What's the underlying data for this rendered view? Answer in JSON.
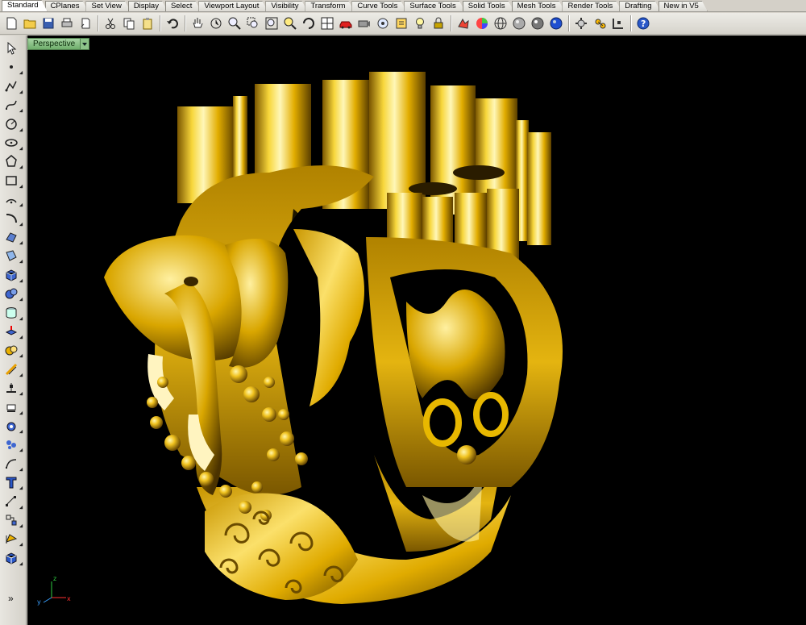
{
  "tabs": [
    {
      "label": "Standard",
      "active": true
    },
    {
      "label": "CPlanes"
    },
    {
      "label": "Set View"
    },
    {
      "label": "Display"
    },
    {
      "label": "Select"
    },
    {
      "label": "Viewport Layout"
    },
    {
      "label": "Visibility"
    },
    {
      "label": "Transform"
    },
    {
      "label": "Curve Tools"
    },
    {
      "label": "Surface Tools"
    },
    {
      "label": "Solid Tools"
    },
    {
      "label": "Mesh Tools"
    },
    {
      "label": "Render Tools"
    },
    {
      "label": "Drafting"
    },
    {
      "label": "New in V5"
    }
  ],
  "toolbar": {
    "icons": [
      "new-icon",
      "open-icon",
      "save-icon",
      "print-icon",
      "template-icon",
      "cut-icon",
      "copy-icon",
      "paste-icon",
      "undo-icon",
      "pan-icon",
      "rotate-icon",
      "zoom-dynamic-icon",
      "zoom-window-icon",
      "zoom-extents-icon",
      "zoom-selected-icon",
      "rotate-view-icon",
      "four-viewports-icon",
      "car-icon",
      "camera-icon",
      "named-views-icon",
      "object-properties-icon",
      "light-bulb-icon",
      "lock-icon",
      "render-icon",
      "color-wheel-icon",
      "wireframe-sphere-icon",
      "shaded-sphere-icon",
      "rendered-sphere-icon",
      "blue-sphere-icon",
      "options-icon",
      "osnap-icon",
      "grid-snap-icon",
      "help-icon"
    ]
  },
  "left_toolbar": {
    "icons": [
      "select-arrow-icon",
      "point-icon",
      "polyline-icon",
      "curve-icon",
      "circle-icon",
      "ellipse-icon",
      "polygon-icon",
      "rectangle-icon",
      "arc-icon",
      "fillet-icon",
      "surface-icon",
      "sweep-icon",
      "box-icon",
      "sphere-icon",
      "cylinder-icon",
      "extrude-icon",
      "boolean-icon",
      "offset-icon",
      "trim-icon",
      "join-icon",
      "explode-icon",
      "group-icon",
      "array-icon",
      "text-icon",
      "dimension-icon",
      "block-icon",
      "layer-icon",
      "mesh-box-icon"
    ],
    "more_label": "»"
  },
  "viewport": {
    "title": "Perspective",
    "background": "#000000",
    "axis": {
      "x": "x",
      "y": "y",
      "z": "z"
    }
  },
  "colors": {
    "gold_light": "#fff2a0",
    "gold": "#e8b800",
    "gold_dark": "#6a4b00",
    "viewport_tab": "#8cc389"
  }
}
